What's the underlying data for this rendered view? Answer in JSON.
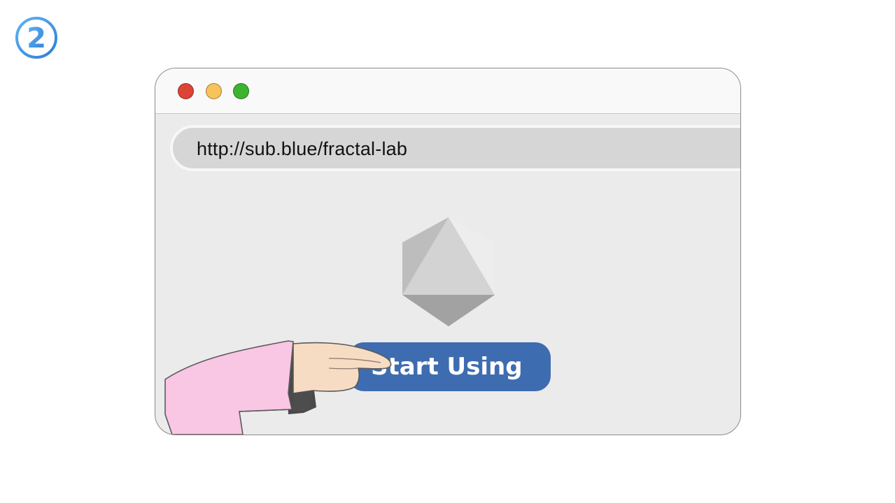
{
  "step": {
    "number": "2"
  },
  "browser": {
    "window_controls": {
      "close": "#db4437",
      "minimize": "#f7c35a",
      "maximize": "#3db42f"
    },
    "address_bar": {
      "url": "http://sub.blue/fractal-lab"
    }
  },
  "page": {
    "logo_icon": "octahedron-icon",
    "start_button_label": "Start Using"
  },
  "illustration": {
    "hand_icon": "pointing-hand-icon"
  },
  "colors": {
    "badge": "#3b8fe0",
    "button": "#3e6cb0",
    "sleeve": "#f9c6e4",
    "skin": "#f7dcc4"
  }
}
